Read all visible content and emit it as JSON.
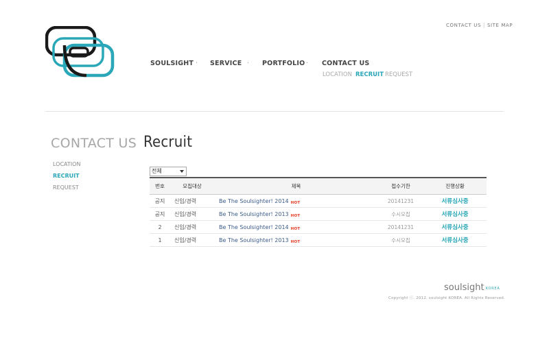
{
  "util_links": [
    "CONTACT US",
    "SITE MAP"
  ],
  "nav": {
    "items": [
      "SOULSIGHT",
      "SERVICE",
      "PORTFOLIO",
      "CONTACT US"
    ],
    "sub": [
      "LOCATION",
      "RECRUIT",
      "REQUEST"
    ],
    "active_sub": "RECRUIT"
  },
  "section": {
    "title": "CONTACT US",
    "menu": [
      "LOCATION",
      "RECRUIT",
      "REQUEST"
    ]
  },
  "page": {
    "title": "Recruit",
    "filter_value": "전체"
  },
  "table": {
    "headers": [
      "번호",
      "모집대상",
      "제목",
      "접수기한",
      "진행상황"
    ],
    "rows": [
      {
        "num": "공지",
        "target": "신입/경력",
        "title": "Be The Soulsighter! 2014",
        "badge": "HOT",
        "deadline": "20141231",
        "status": "서류심사중"
      },
      {
        "num": "공지",
        "target": "신입/경력",
        "title": "Be The Soulsighter! 2013",
        "badge": "HOT",
        "deadline": "수시모집",
        "status": "서류심사중"
      },
      {
        "num": "2",
        "target": "신입/경력",
        "title": "Be The Soulsighter! 2014",
        "badge": "HOT",
        "deadline": "20141231",
        "status": "서류심사중"
      },
      {
        "num": "1",
        "target": "신입/경력",
        "title": "Be The Soulsighter! 2013",
        "badge": "HOT",
        "deadline": "수시모집",
        "status": "서류심사중"
      }
    ]
  },
  "footer": {
    "brand": "soulsight",
    "brand_sub": "KOREA",
    "copyright": "Copyright ⓒ. 2012. soulsight KOREA. All Rights Reserved."
  },
  "colors": {
    "accent": "#2aa7b8",
    "hot": "#e2361c"
  }
}
